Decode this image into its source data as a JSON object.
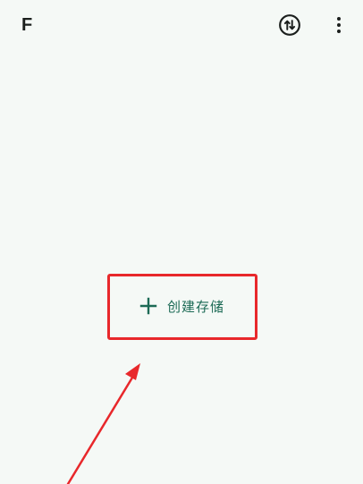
{
  "app_bar": {
    "title": "F",
    "sync_icon": "sync-swap-icon",
    "more_icon": "more-vert-icon"
  },
  "main": {
    "create_storage_label": "创建存储",
    "create_icon": "plus-icon"
  },
  "annotation": {
    "highlight_color": "#e8282b",
    "arrow_color": "#e8282b"
  },
  "colors": {
    "background": "#f5f9f6",
    "accent": "#1c6a55",
    "text": "#1b1f1d"
  }
}
